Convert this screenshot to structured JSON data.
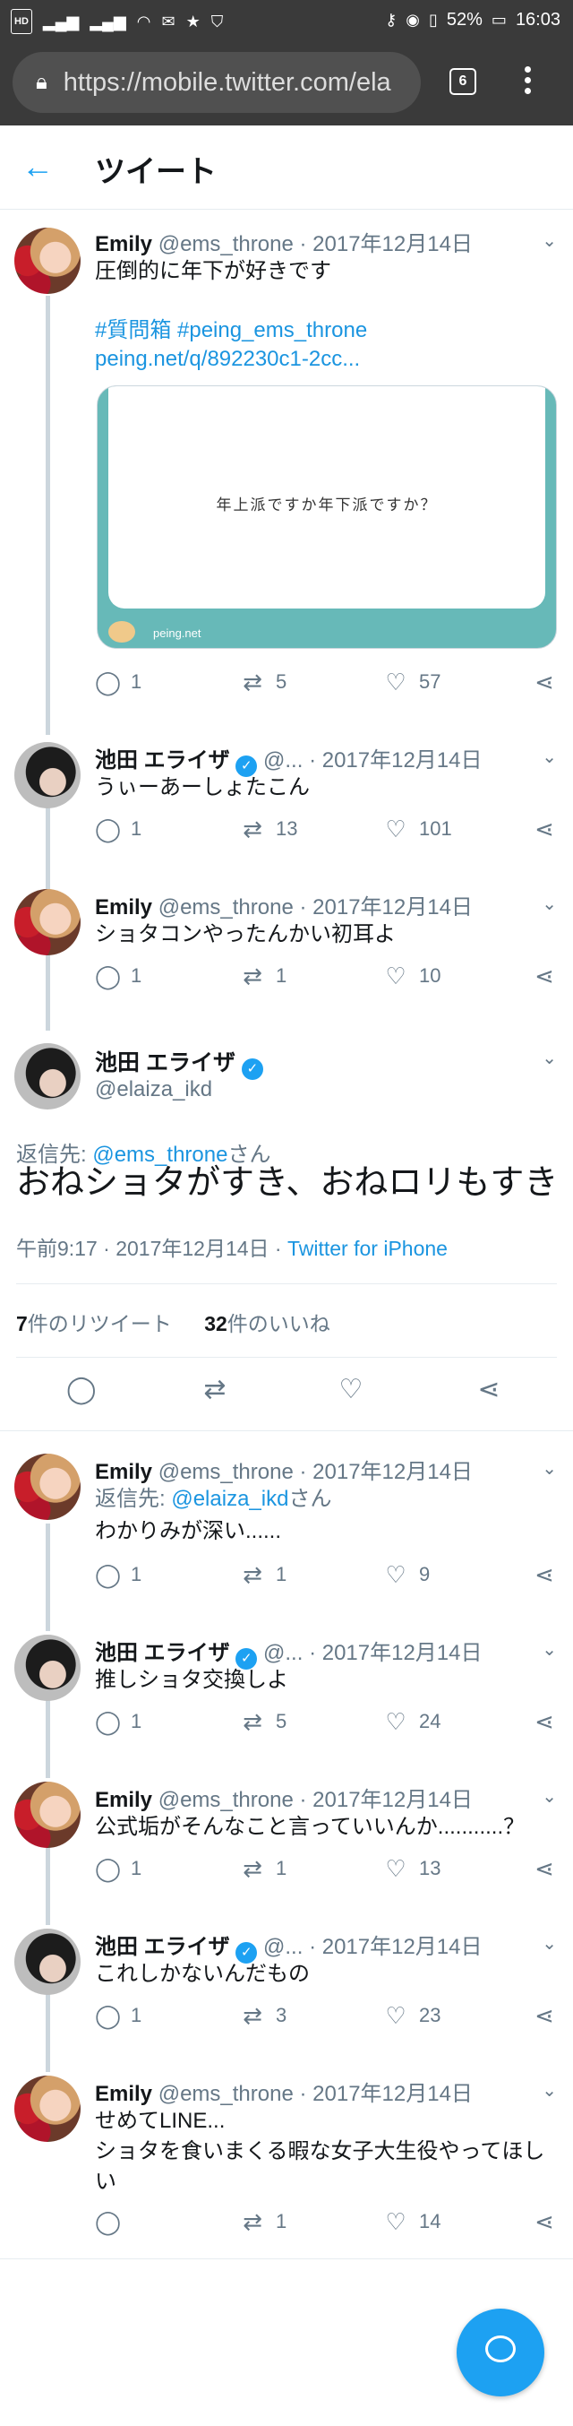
{
  "status_bar": {
    "left_icons": [
      "HD",
      "signal-icon",
      "signal-icon",
      "wifi-icon",
      "mail-icon",
      "star-icon",
      "shield-icon"
    ],
    "battery": "52%",
    "time": "16:03",
    "hd": "HD"
  },
  "browser": {
    "url": "https://mobile.twitter.com/ela",
    "tab_count": "6"
  },
  "header": {
    "title": "ツイート"
  },
  "tweets_before": [
    {
      "name": "Emily",
      "handle": "@ems_throne",
      "date": "· 2017年12月14日",
      "verified": false,
      "text": "圧倒的に年下が好きです",
      "hashtags": "#質問箱 #peing_ems_throne",
      "link": "peing.net/q/892230c1-2cc...",
      "card_text": "年上派ですか年下派ですか？",
      "card_footer": "peing.net",
      "replies": "1",
      "retweets": "5",
      "likes": "57"
    },
    {
      "name": "池田 エライザ",
      "handle": "@...",
      "date": "· 2017年12月14日",
      "verified": true,
      "text": "うぃーあーしょたこん",
      "replies": "1",
      "retweets": "13",
      "likes": "101"
    },
    {
      "name": "Emily",
      "handle": "@ems_throne",
      "date": "· 2017年12月14日",
      "verified": false,
      "text": "ショタコンやったんかい初耳よ",
      "replies": "1",
      "retweets": "1",
      "likes": "10"
    }
  ],
  "focus": {
    "name": "池田 エライザ",
    "handle": "@elaiza_ikd",
    "reply_prefix": "返信先: ",
    "reply_to": "@ems_throne",
    "reply_suffix": "さん",
    "text": "おねショタがすき、おねロリもすき",
    "time": "午前9:17 · 2017年12月14日 · ",
    "source": "Twitter for iPhone",
    "retweet_count": "7",
    "retweet_label": "件のリツイート",
    "like_count": "32",
    "like_label": "件のいいね"
  },
  "tweets_after": [
    {
      "name": "Emily",
      "handle": "@ems_throne",
      "date": "· 2017年12月14日",
      "verified": false,
      "reply_prefix": "返信先: ",
      "reply_to": "@elaiza_ikd",
      "reply_suffix": "さん",
      "text": "わかりみが深い......",
      "replies": "1",
      "retweets": "1",
      "likes": "9"
    },
    {
      "name": "池田 エライザ",
      "handle": "@...",
      "date": "· 2017年12月14日",
      "verified": true,
      "text": "推しショタ交換しよ",
      "replies": "1",
      "retweets": "5",
      "likes": "24"
    },
    {
      "name": "Emily",
      "handle": "@ems_throne",
      "date": "· 2017年12月14日",
      "verified": false,
      "text": "公式垢がそんなこと言っていいんか...........？",
      "replies": "1",
      "retweets": "1",
      "likes": "13"
    },
    {
      "name": "池田 エライザ",
      "handle": "@...",
      "date": "· 2017年12月14日",
      "verified": true,
      "text": "これしかないんだもの",
      "replies": "1",
      "retweets": "3",
      "likes": "23"
    },
    {
      "name": "Emily",
      "handle": "@ems_throne",
      "date": "· 2017年12月14日",
      "verified": false,
      "text": "せめてLINE...",
      "text2": "ショタを食いまくる暇な女子大生役やってほしい",
      "replies": "",
      "retweets": "1",
      "likes": "14"
    }
  ],
  "colors": {
    "accent": "#1da1f2",
    "link": "#1b95e0",
    "gray": "#657786",
    "thread": "#ccd6dd"
  }
}
